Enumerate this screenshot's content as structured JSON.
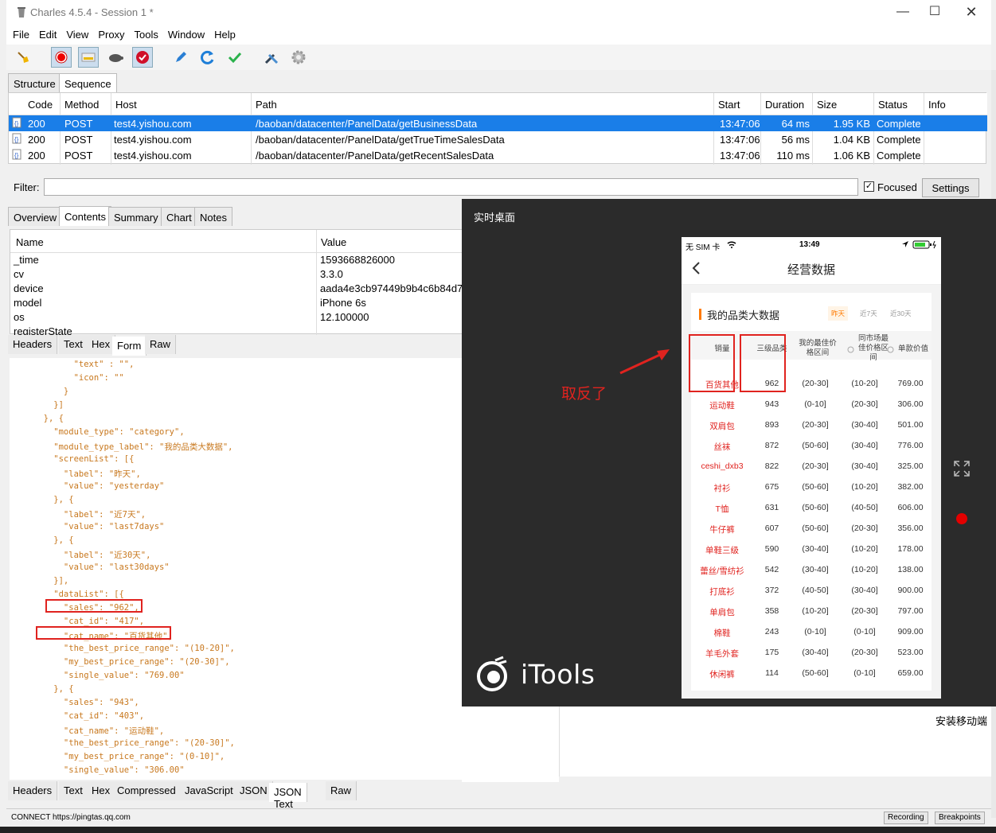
{
  "window": {
    "title": "Charles 4.5.4 - Session 1 *"
  },
  "menu": [
    "File",
    "Edit",
    "View",
    "Proxy",
    "Tools",
    "Window",
    "Help"
  ],
  "toolbar_icons": [
    "broom-icon",
    "record-icon",
    "throttle-icon",
    "turtle-icon",
    "breakpoint-icon",
    "pen-icon",
    "refresh-icon",
    "check-icon",
    "tools-icon",
    "gear-icon"
  ],
  "view_tabs": [
    "Structure",
    "Sequence"
  ],
  "sequence": {
    "columns": [
      "Code",
      "Method",
      "Host",
      "Path",
      "Start",
      "Duration",
      "Size",
      "Status",
      "Info"
    ],
    "rows": [
      {
        "code": "200",
        "method": "POST",
        "host": "test4.yishou.com",
        "path": "/baoban/datacenter/PanelData/getBusinessData",
        "start": "13:47:06",
        "duration": "64 ms",
        "size": "1.95 KB",
        "status": "Complete"
      },
      {
        "code": "200",
        "method": "POST",
        "host": "test4.yishou.com",
        "path": "/baoban/datacenter/PanelData/getTrueTimeSalesData",
        "start": "13:47:06",
        "duration": "56 ms",
        "size": "1.04 KB",
        "status": "Complete"
      },
      {
        "code": "200",
        "method": "POST",
        "host": "test4.yishou.com",
        "path": "/baoban/datacenter/PanelData/getRecentSalesData",
        "start": "13:47:06",
        "duration": "110 ms",
        "size": "1.06 KB",
        "status": "Complete"
      }
    ]
  },
  "filter": {
    "label": "Filter:",
    "value": "",
    "focused_label": "Focused",
    "settings_label": "Settings"
  },
  "detail_tabs": [
    "Overview",
    "Contents",
    "Summary",
    "Chart",
    "Notes"
  ],
  "params": {
    "columns": [
      "Name",
      "Value"
    ],
    "rows": [
      {
        "name": "_time",
        "value": "1593668826000"
      },
      {
        "name": "cv",
        "value": "3.3.0"
      },
      {
        "name": "device",
        "value": "aada4e3cb97449b9b4c6b84d7"
      },
      {
        "name": "model",
        "value": "iPhone 6s"
      },
      {
        "name": "os",
        "value": "12.100000"
      },
      {
        "name": "registerState",
        "value": ""
      }
    ]
  },
  "request_tabs": [
    "Headers",
    "Text",
    "Hex",
    "Form",
    "Raw"
  ],
  "json_lines": [
    "        \"text\" : \"\",",
    "        \"icon\": \"\"",
    "      }",
    "    }]",
    "  }, {",
    "    \"module_type\": \"category\",",
    "    \"module_type_label\": \"我的品类大数据\",",
    "    \"screenList\": [{",
    "      \"label\": \"昨天\",",
    "      \"value\": \"yesterday\"",
    "    }, {",
    "      \"label\": \"近7天\",",
    "      \"value\": \"last7days\"",
    "    }, {",
    "      \"label\": \"近30天\",",
    "      \"value\": \"last30days\"",
    "    }],",
    "    \"dataList\": [{",
    "      \"sales\": \"962\",",
    "      \"cat_id\": \"417\",",
    "      \"cat_name\": \"百货其他\",",
    "      \"the_best_price_range\": \"(10-20]\",",
    "      \"my_best_price_range\": \"(20-30]\",",
    "      \"single_value\": \"769.00\"",
    "    }, {",
    "      \"sales\": \"943\",",
    "      \"cat_id\": \"403\",",
    "      \"cat_name\": \"运动鞋\",",
    "      \"the_best_price_range\": \"(20-30]\",",
    "      \"my_best_price_range\": \"(0-10]\",",
    "      \"single_value\": \"306.00\""
  ],
  "response_tabs": [
    "Headers",
    "Text",
    "Hex",
    "Compressed",
    "JavaScript",
    "JSON",
    "JSON Text",
    "Raw"
  ],
  "status": {
    "text": "CONNECT https://pingtas.qq.com",
    "recording": "Recording",
    "breakpoints": "Breakpoints"
  },
  "background_text": "安装移动端",
  "itools": {
    "title": "实时桌面",
    "logo_text": "iTools",
    "annotation": "取反了",
    "phone": {
      "carrier": "无 SIM 卡",
      "time": "13:49",
      "page_title": "经营数据",
      "card_title": "我的品类大数据",
      "segments": [
        "昨天",
        "近7天",
        "近30天"
      ],
      "headers": [
        "销量",
        "三级品类",
        "我的最佳价格区间",
        "同市场最佳价格区间",
        "单款价值"
      ],
      "rows": [
        [
          "百货其他",
          "962",
          "(20-30]",
          "(10-20]",
          "769.00"
        ],
        [
          "运动鞋",
          "943",
          "(0-10]",
          "(20-30]",
          "306.00"
        ],
        [
          "双肩包",
          "893",
          "(20-30]",
          "(30-40]",
          "501.00"
        ],
        [
          "丝袜",
          "872",
          "(50-60]",
          "(30-40]",
          "776.00"
        ],
        [
          "ceshi_dxb3",
          "822",
          "(20-30]",
          "(30-40]",
          "325.00"
        ],
        [
          "衬衫",
          "675",
          "(50-60]",
          "(10-20]",
          "382.00"
        ],
        [
          "T恤",
          "631",
          "(50-60]",
          "(40-50]",
          "606.00"
        ],
        [
          "牛仔裤",
          "607",
          "(50-60]",
          "(20-30]",
          "356.00"
        ],
        [
          "单鞋三级",
          "590",
          "(30-40]",
          "(10-20]",
          "178.00"
        ],
        [
          "蕾丝/雪纺衫",
          "542",
          "(30-40]",
          "(10-20]",
          "138.00"
        ],
        [
          "打底衫",
          "372",
          "(40-50]",
          "(30-40]",
          "900.00"
        ],
        [
          "单肩包",
          "358",
          "(10-20]",
          "(20-30]",
          "797.00"
        ],
        [
          "棉鞋",
          "243",
          "(0-10]",
          "(0-10]",
          "909.00"
        ],
        [
          "羊毛外套",
          "175",
          "(30-40]",
          "(20-30]",
          "523.00"
        ],
        [
          "休闲裤",
          "114",
          "(50-60]",
          "(0-10]",
          "659.00"
        ]
      ]
    }
  }
}
